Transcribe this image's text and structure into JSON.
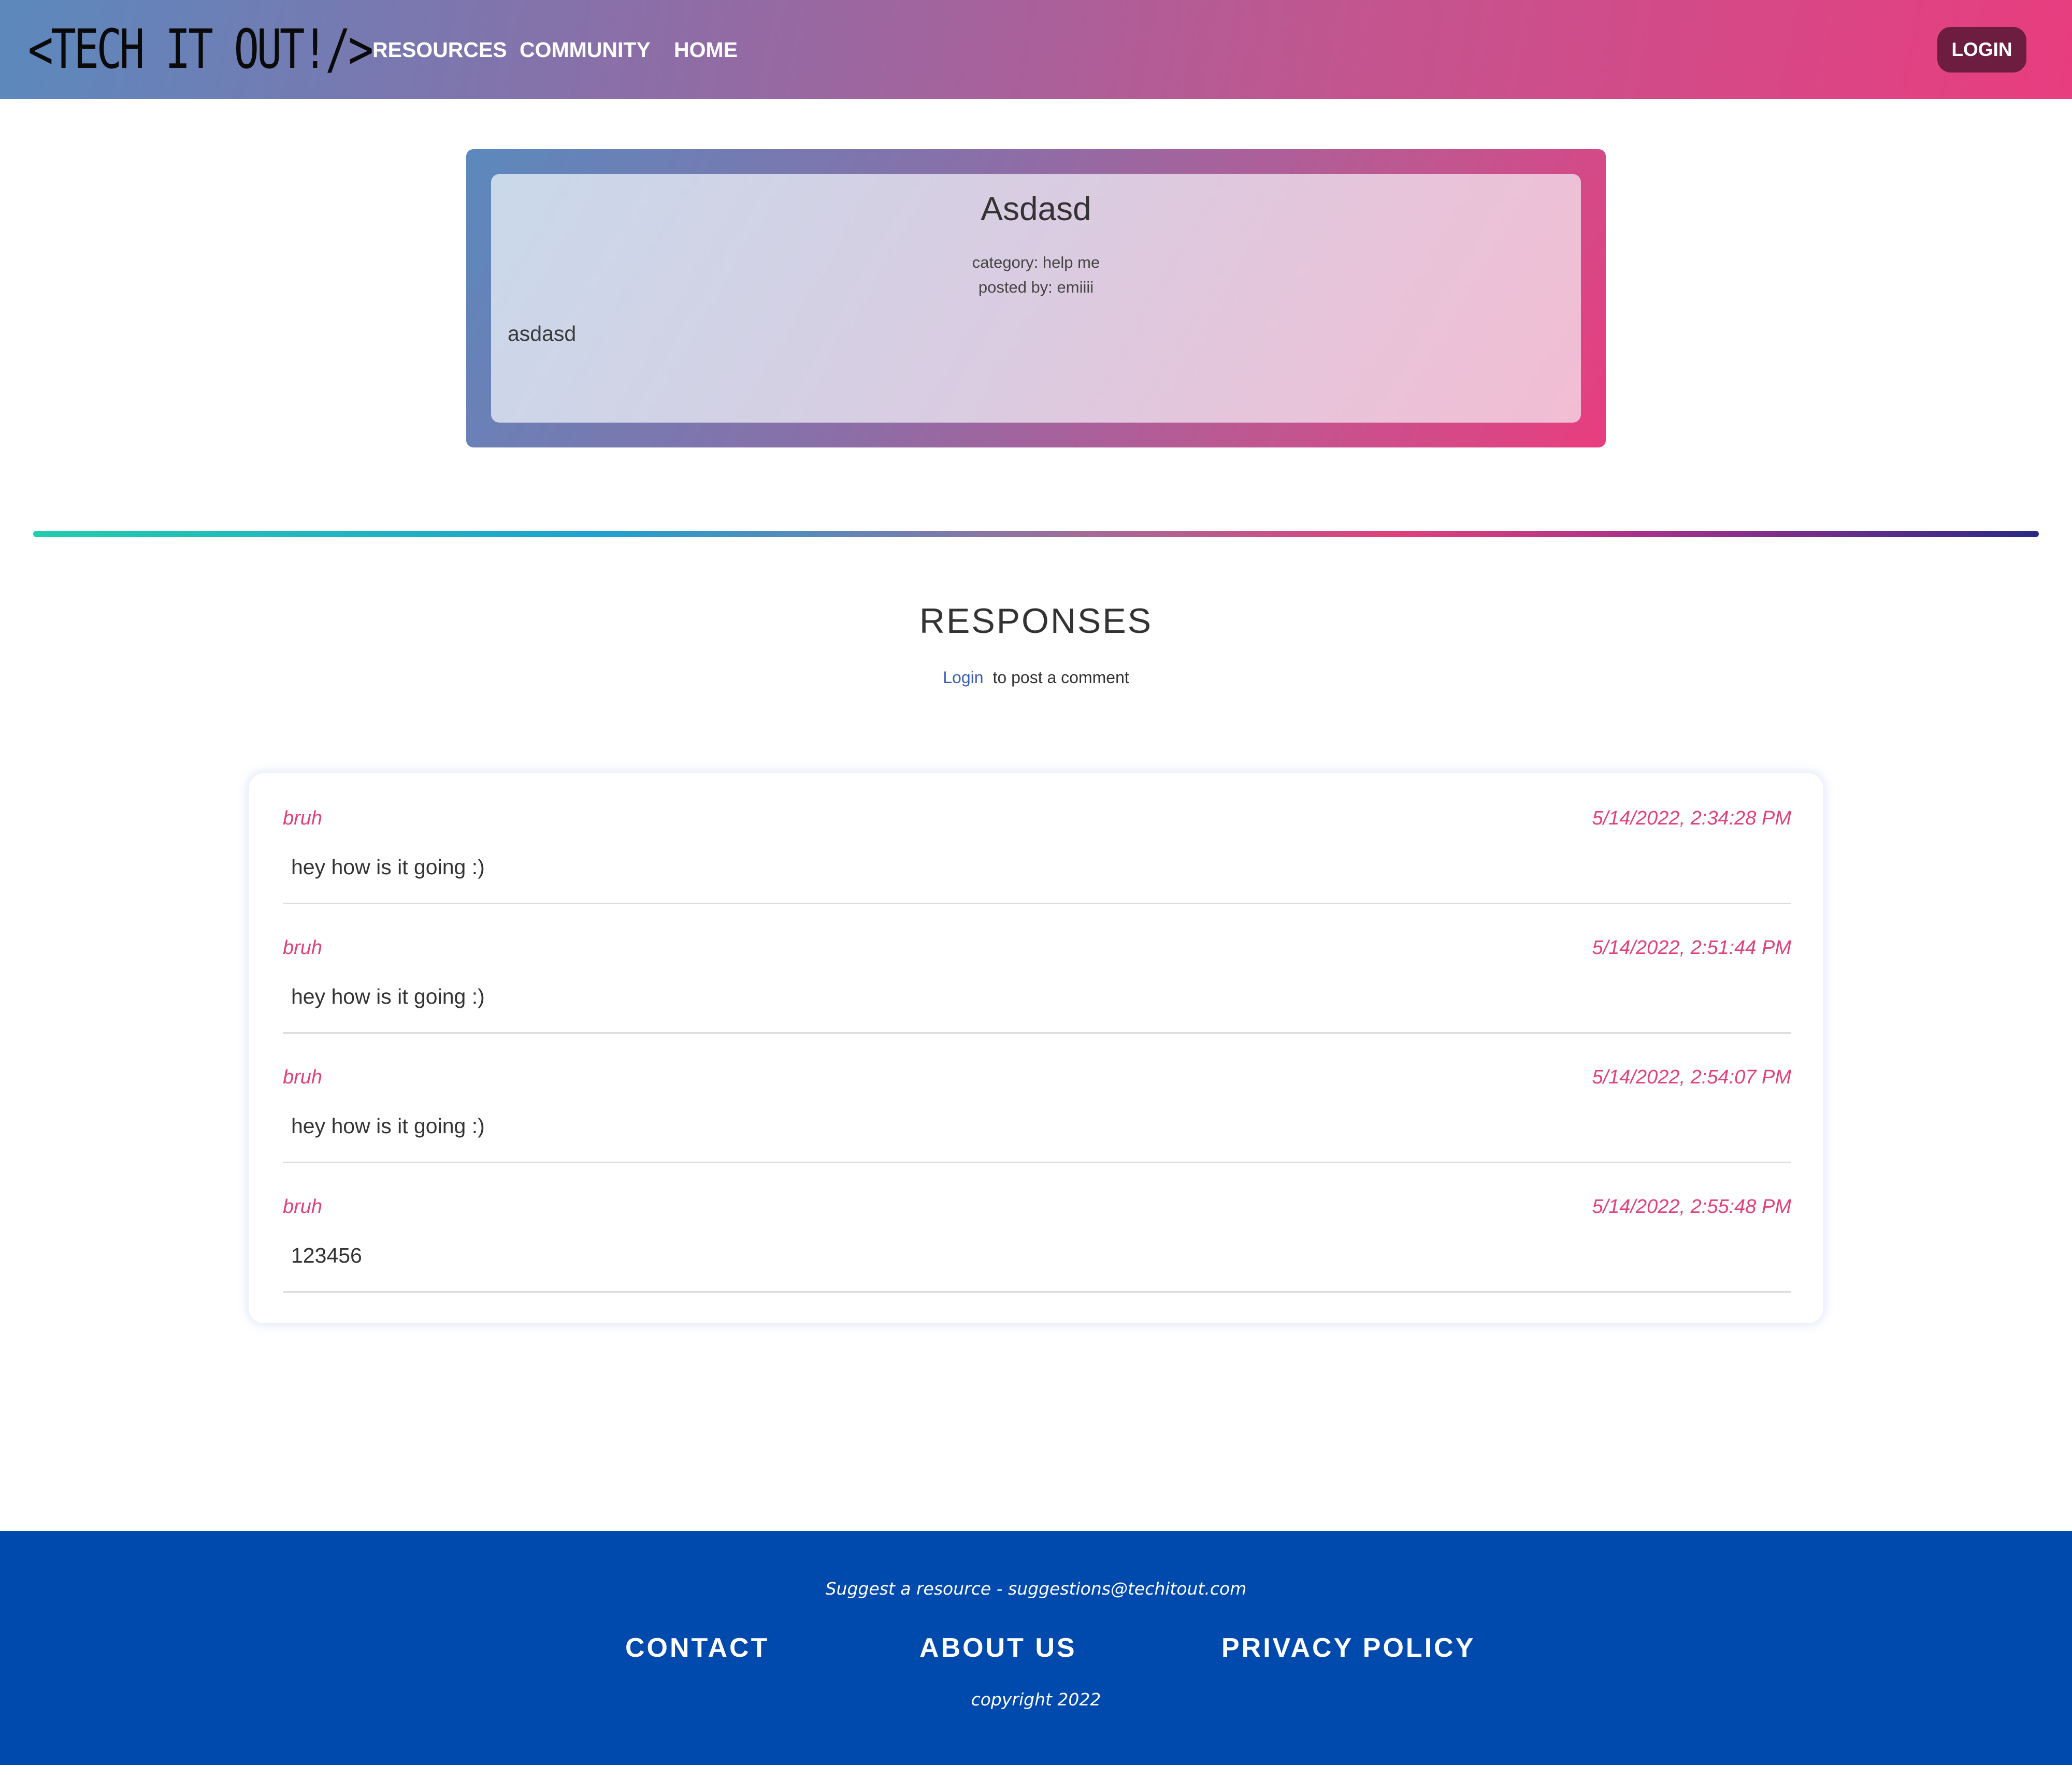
{
  "navbar": {
    "logo_text": "<TECH IT OUT!/>",
    "links": [
      "RESOURCES",
      "COMMUNITY",
      "HOME"
    ],
    "login_label": "LOGIN"
  },
  "post": {
    "title": "Asdasd",
    "category": "category: help me",
    "author": "posted by: emiiii",
    "body": "asdasd"
  },
  "responses": {
    "heading": "RESPONSES",
    "login_link": "Login",
    "login_suffix": "to post a comment",
    "comments": [
      {
        "user": "bruh",
        "time": "5/14/2022, 2:34:28 PM",
        "text": "hey how is it going :)"
      },
      {
        "user": "bruh",
        "time": "5/14/2022, 2:51:44 PM",
        "text": "hey how is it going :)"
      },
      {
        "user": "bruh",
        "time": "5/14/2022, 2:54:07 PM",
        "text": "hey how is it going :)"
      },
      {
        "user": "bruh",
        "time": "5/14/2022, 2:55:48 PM",
        "text": "123456"
      }
    ]
  },
  "footer": {
    "suggest": "Suggest a resource - suggestions@techitout.com",
    "links": [
      "CONTACT",
      "ABOUT US",
      "PRIVACY POLICY"
    ],
    "copyright": "copyright 2022"
  },
  "colors": {
    "accent_pink": "#e0407b",
    "login_button": "#6d1d3f",
    "footer_bg": "#004aad",
    "link_blue": "#3c5fb5"
  }
}
